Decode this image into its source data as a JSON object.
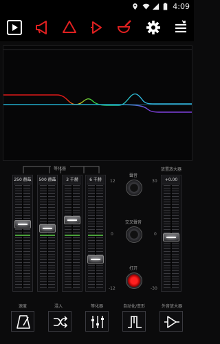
{
  "status_bar": {
    "time": "4:09"
  },
  "toolbar": {
    "icons": [
      "play-icon",
      "megaphone-icon",
      "triangle-alert-icon",
      "arrow-right-icon",
      "pestle-icon",
      "gear-icon",
      "menu-collapse-icon"
    ]
  },
  "eq_bands": {
    "group_label": "等化器",
    "bands": [
      {
        "label": "250 赫茲",
        "value_db": 3
      },
      {
        "label": "500 赫茲",
        "value_db": 2
      },
      {
        "label": "3 千赫",
        "value_db": 4
      },
      {
        "label": "6 千赫",
        "value_db": -5
      }
    ],
    "scale": {
      "max": "12",
      "mid": "0",
      "min": "-12"
    }
  },
  "knobs": {
    "balance_label": "聲音",
    "crossover_label": "交叉聲音",
    "toggle_label": "打开"
  },
  "preamp": {
    "label": "放置放大器",
    "value": "+0.00",
    "value_db": 0,
    "scale": {
      "max": "30",
      "mid": "0",
      "min": "-30"
    }
  },
  "bottom_buttons": [
    {
      "label": "速度",
      "icon": "metronome-icon"
    },
    {
      "label": "混入",
      "icon": "shuffle-icon"
    },
    {
      "label": "等化器",
      "icon": "equalizer-icon"
    },
    {
      "label": "自动化/变形",
      "icon": "pulse-icon"
    },
    {
      "label": "外音放大器",
      "icon": "amplifier-icon"
    }
  ],
  "colors": {
    "accent_red": "#e02020",
    "bg": "#0b0b0c",
    "zero_line": "#4aa23a"
  }
}
